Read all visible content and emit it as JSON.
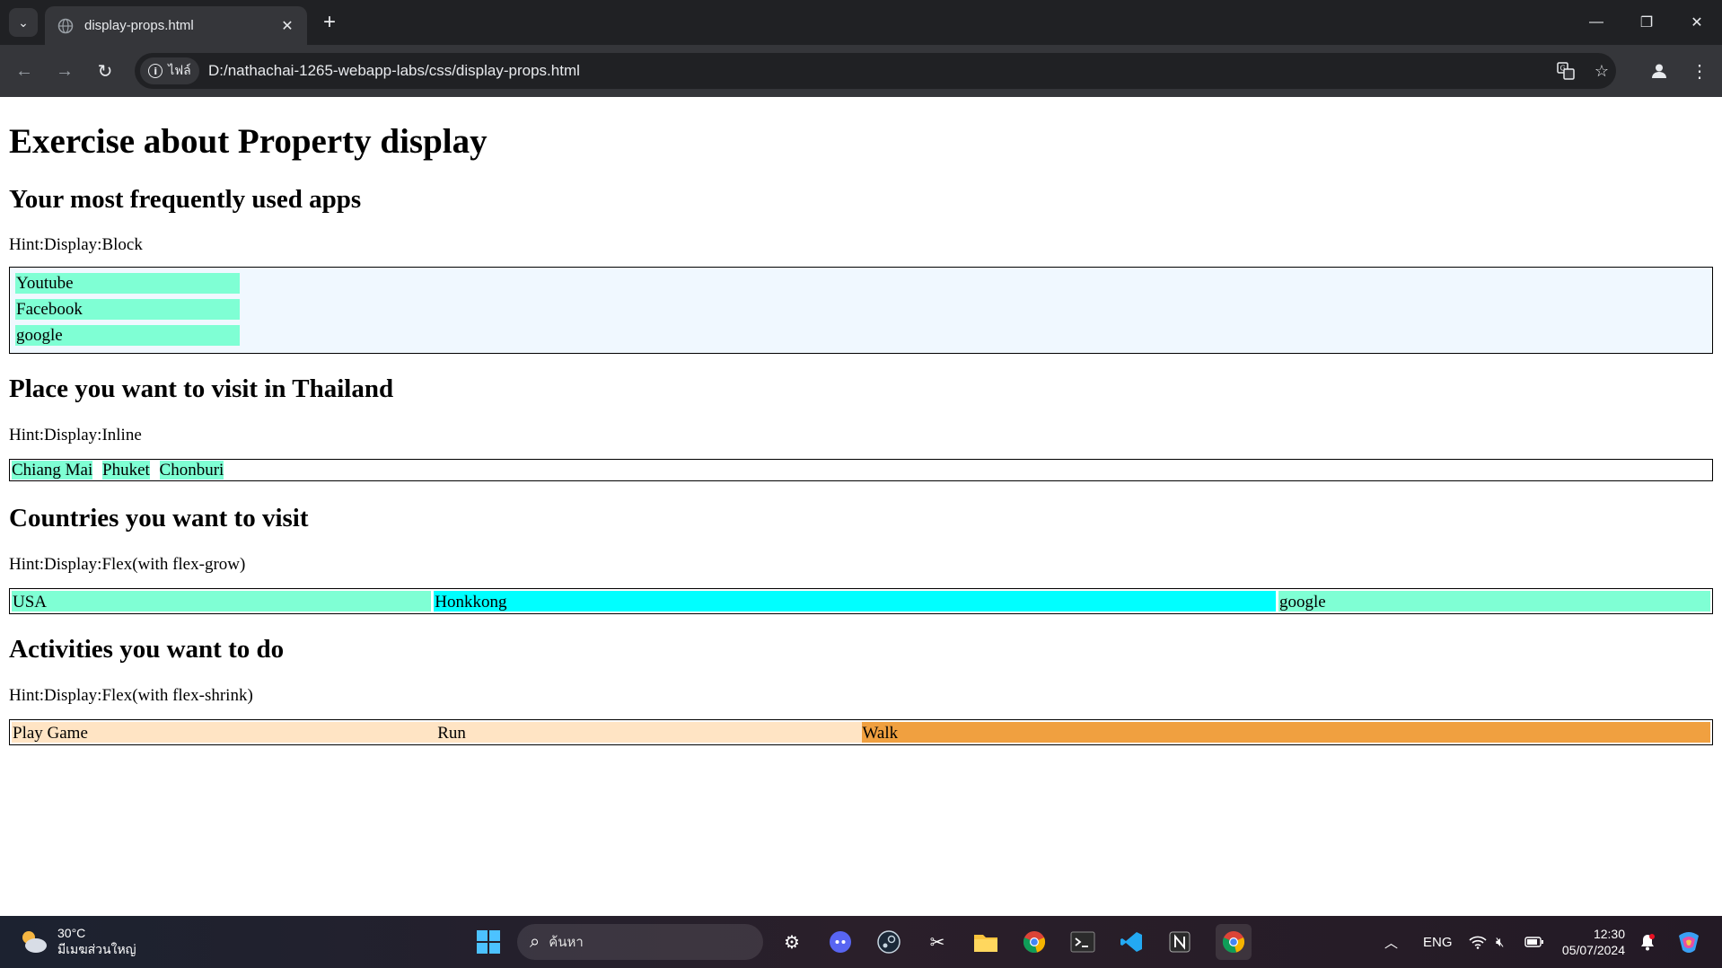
{
  "browser": {
    "tab_title": "display-props.html",
    "site_info_label": "ไฟล์",
    "url": "D:/nathachai-1265-webapp-labs/css/display-props.html"
  },
  "page": {
    "title": "Exercise about Property display",
    "sections": [
      {
        "heading": "Your most frequently used apps",
        "hint": "Hint:Display:Block",
        "items": [
          "Youtube",
          "Facebook",
          "google"
        ]
      },
      {
        "heading": "Place you want to visit in Thailand",
        "hint": "Hint:Display:Inline",
        "items": [
          "Chiang Mai",
          "Phuket",
          "Chonburi"
        ]
      },
      {
        "heading": "Countries you want to visit",
        "hint": "Hint:Display:Flex(with flex-grow)",
        "items": [
          "USA",
          "Honkkong",
          "google"
        ]
      },
      {
        "heading": "Activities you want to do",
        "hint": "Hint:Display:Flex(with flex-shrink)",
        "items": [
          "Play Game",
          "Run",
          "Walk"
        ]
      }
    ]
  },
  "colors": {
    "aquamarine": "#7fffd4",
    "cyan": "#00ffff",
    "aliceblue": "#f0f8ff",
    "bisque": "#ffe4c4",
    "orange": "#f0a040"
  },
  "taskbar": {
    "weather_temp": "30°C",
    "weather_desc": "มีเมฆส่วนใหญ่",
    "search_placeholder": "ค้นหา",
    "language": "ENG",
    "time": "12:30",
    "date": "05/07/2024"
  }
}
